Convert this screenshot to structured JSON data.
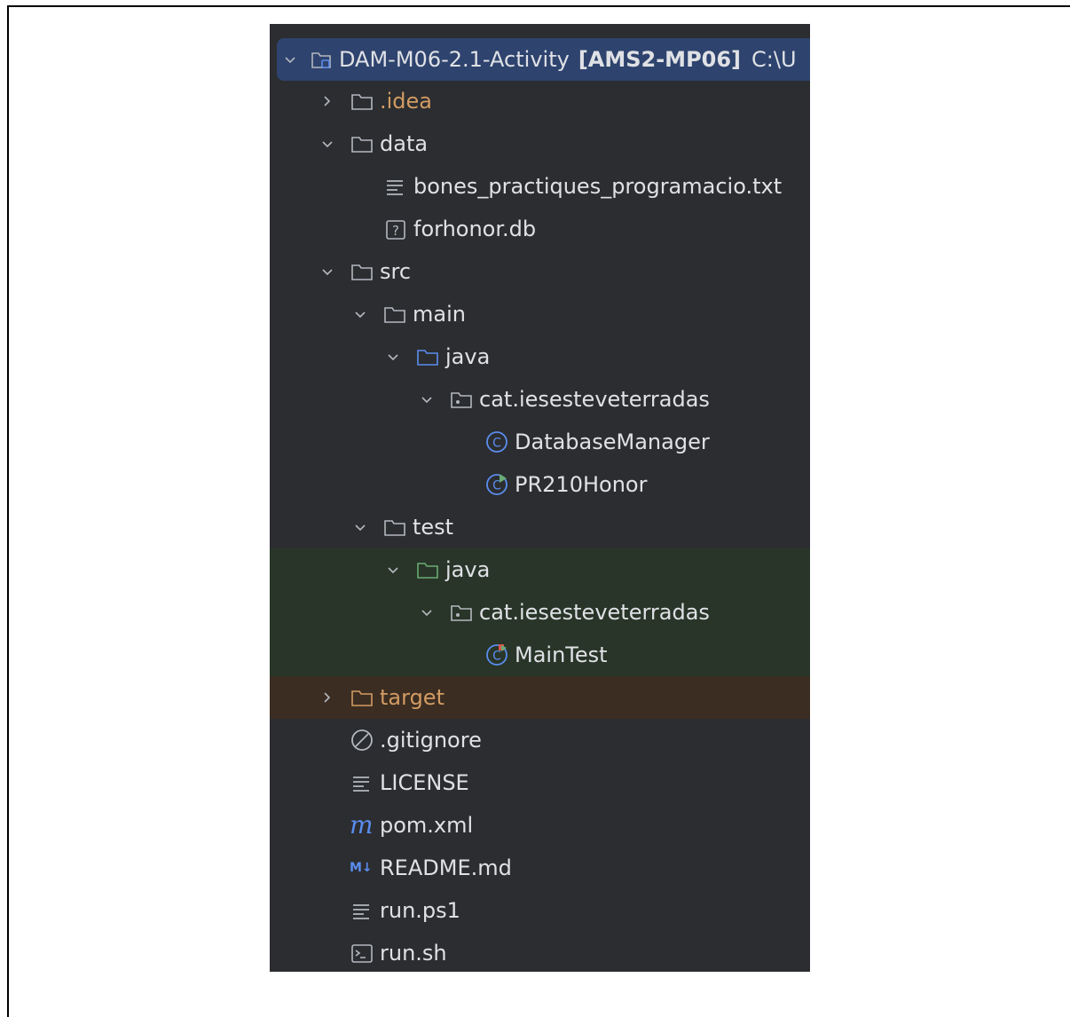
{
  "project": {
    "name": "DAM-M06-2.1-Activity",
    "module": "[AMS2-MP06]",
    "path": "C:\\U"
  },
  "tree": {
    "idea": ".idea",
    "data": "data",
    "data_files": [
      "bones_practiques_programacio.txt",
      "forhonor.db"
    ],
    "src": "src",
    "main": "main",
    "main_java": "java",
    "main_package": "cat.iesesteveterradas",
    "main_classes": [
      "DatabaseManager",
      "PR210Honor"
    ],
    "test": "test",
    "test_java": "java",
    "test_package": "cat.iesesteveterradas",
    "test_classes": [
      "MainTest"
    ],
    "target": "target",
    "root_files": [
      ".gitignore",
      "LICENSE",
      "pom.xml",
      "README.md",
      "run.ps1",
      "run.sh"
    ]
  },
  "icons": {
    "folder": "folder-icon",
    "module": "module-folder-icon",
    "text_file": "text-file-icon",
    "unknown_file": "unknown-file-icon",
    "package": "package-icon",
    "class": "class-icon",
    "main_class": "main-class-icon",
    "test_class": "test-class-icon",
    "gitignore": "ignore-icon",
    "maven": "maven-icon",
    "markdown": "markdown-icon",
    "shell": "shell-icon"
  },
  "colors": {
    "panel_bg": "#2b2d30",
    "selection": "#2e436e",
    "test_bg": "#283528",
    "excluded_bg": "#3b2d22",
    "text": "#dfe1e5",
    "excluded_text": "#d29b63",
    "accent_blue": "#5b8def",
    "test_green": "#6aab73"
  }
}
